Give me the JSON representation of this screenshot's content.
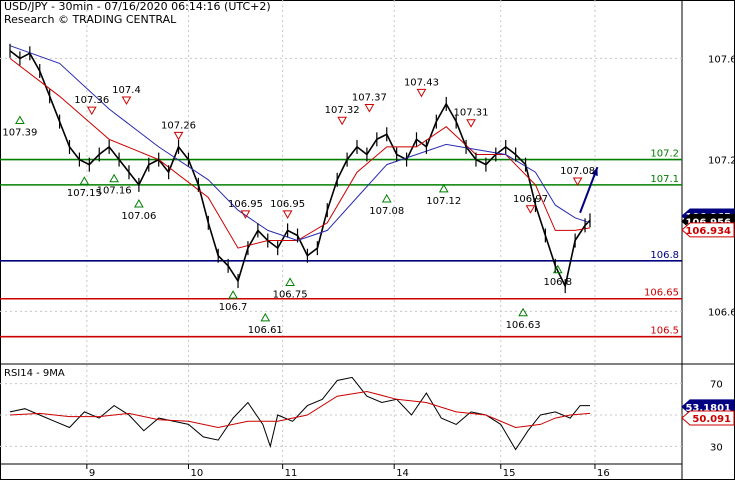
{
  "header": {
    "title": "USD/JPY - 30min - 07/16/2020 06:14:16 (UTC+2)",
    "source": "Research © TRADING CENTRAL"
  },
  "colors": {
    "price": "#000000",
    "ma_fast": "#cc0000",
    "ma_slow": "#2b2bb0",
    "resistance": "#008000",
    "pivot": "#000080",
    "support": "#cc0000",
    "arrow": "#000080",
    "grid": "#c8c8c8",
    "badge_dark": "#000000",
    "badge_blue": "#000080",
    "badge_red": "#cc0000"
  },
  "chart_data": [
    {
      "type": "line",
      "name": "price-panel",
      "ylim": [
        106.4,
        107.72
      ],
      "yticks": [
        106.6,
        107.2,
        107.6
      ],
      "ytick_labels": [
        "106.6",
        "107.2",
        "107.6"
      ],
      "xlim": [
        0,
        23.4
      ],
      "xticks": [
        3.1,
        7.2,
        11.0,
        15.5,
        19.8,
        23.6
      ],
      "xtick_labels": [
        "9",
        "10",
        "11",
        "14",
        "15",
        "16"
      ],
      "series": [
        {
          "key": "price",
          "x": [
            0,
            0.4,
            0.8,
            1.2,
            1.6,
            2.0,
            2.4,
            2.8,
            3.2,
            3.6,
            4.0,
            4.4,
            4.8,
            5.2,
            5.6,
            6.0,
            6.4,
            6.8,
            7.2,
            7.6,
            8.0,
            8.4,
            8.8,
            9.2,
            9.6,
            10.0,
            10.4,
            10.8,
            11.2,
            11.6,
            12.0,
            12.4,
            12.8,
            13.2,
            13.6,
            14.0,
            14.4,
            14.8,
            15.2,
            15.6,
            16.0,
            16.4,
            16.8,
            17.2,
            17.6,
            18.0,
            18.4,
            18.8,
            19.2,
            19.6,
            20.0,
            20.4,
            20.8,
            21.2,
            21.6,
            22.0,
            22.4,
            22.8,
            23.2,
            23.4
          ],
          "y": [
            107.63,
            107.6,
            107.62,
            107.55,
            107.45,
            107.35,
            107.25,
            107.2,
            107.18,
            107.22,
            107.25,
            107.2,
            107.15,
            107.1,
            107.18,
            107.2,
            107.15,
            107.25,
            107.2,
            107.1,
            106.95,
            106.82,
            106.78,
            106.72,
            106.85,
            106.92,
            106.88,
            106.85,
            106.92,
            106.9,
            106.82,
            106.85,
            107.0,
            107.12,
            107.2,
            107.25,
            107.22,
            107.28,
            107.3,
            107.22,
            107.2,
            107.28,
            107.25,
            107.35,
            107.42,
            107.35,
            107.25,
            107.2,
            107.18,
            107.22,
            107.25,
            107.22,
            107.18,
            107.02,
            106.9,
            106.78,
            106.7,
            106.88,
            106.94,
            106.96
          ]
        },
        {
          "key": "ma_fast",
          "x": [
            0,
            2.0,
            4.0,
            6.0,
            8.0,
            9.2,
            10.4,
            11.6,
            12.8,
            14.0,
            15.2,
            16.4,
            17.6,
            18.8,
            20.0,
            21.2,
            22.0,
            22.8,
            23.4
          ],
          "y": [
            107.6,
            107.45,
            107.28,
            107.2,
            107.05,
            106.85,
            106.88,
            106.88,
            106.95,
            107.15,
            107.25,
            107.25,
            107.33,
            107.22,
            107.22,
            107.1,
            106.92,
            106.92,
            106.93
          ]
        },
        {
          "key": "ma_slow",
          "x": [
            0,
            2.0,
            4.0,
            6.0,
            8.0,
            9.2,
            10.4,
            11.6,
            12.8,
            14.0,
            15.2,
            16.4,
            17.6,
            18.8,
            20.0,
            21.2,
            22.0,
            22.8,
            23.4
          ],
          "y": [
            107.65,
            107.58,
            107.4,
            107.25,
            107.12,
            107.0,
            106.92,
            106.88,
            106.92,
            107.05,
            107.18,
            107.22,
            107.26,
            107.24,
            107.22,
            107.15,
            107.02,
            106.97,
            106.95
          ]
        }
      ],
      "levels": [
        {
          "value": 107.2,
          "label": "107.2",
          "role": "resistance"
        },
        {
          "value": 107.1,
          "label": "107.1",
          "role": "resistance"
        },
        {
          "value": 106.8,
          "label": "106.8",
          "role": "pivot"
        },
        {
          "value": 106.65,
          "label": "106.65",
          "role": "support"
        },
        {
          "value": 106.5,
          "label": "106.5",
          "role": "support"
        }
      ],
      "last_price_badges": [
        {
          "value": 106.965,
          "label": "106.965",
          "style": "blue"
        },
        {
          "value": 106.956,
          "label": "106.956",
          "style": "dark"
        },
        {
          "value": 106.934,
          "label": "106.934",
          "style": "red"
        }
      ],
      "swing_markers": [
        {
          "x": 0.4,
          "y": 107.39,
          "label": "107.39",
          "kind": "low"
        },
        {
          "x": 3.0,
          "y": 107.15,
          "label": "107.15",
          "kind": "low"
        },
        {
          "x": 3.3,
          "y": 107.36,
          "label": "107.36",
          "kind": "high"
        },
        {
          "x": 4.2,
          "y": 107.16,
          "label": "107.16",
          "kind": "low"
        },
        {
          "x": 4.7,
          "y": 107.4,
          "label": "107.4",
          "kind": "high"
        },
        {
          "x": 5.2,
          "y": 107.06,
          "label": "107.06",
          "kind": "low"
        },
        {
          "x": 6.8,
          "y": 107.26,
          "label": "107.26",
          "kind": "high"
        },
        {
          "x": 9.5,
          "y": 106.95,
          "label": "106.95",
          "kind": "high"
        },
        {
          "x": 9.0,
          "y": 106.7,
          "label": "106.7",
          "kind": "low"
        },
        {
          "x": 10.3,
          "y": 106.61,
          "label": "106.61",
          "kind": "low"
        },
        {
          "x": 11.2,
          "y": 106.95,
          "label": "106.95",
          "kind": "high"
        },
        {
          "x": 11.3,
          "y": 106.75,
          "label": "106.75",
          "kind": "low"
        },
        {
          "x": 13.4,
          "y": 107.32,
          "label": "107.32",
          "kind": "high"
        },
        {
          "x": 14.5,
          "y": 107.37,
          "label": "107.37",
          "kind": "high"
        },
        {
          "x": 15.2,
          "y": 107.08,
          "label": "107.08",
          "kind": "low"
        },
        {
          "x": 16.6,
          "y": 107.43,
          "label": "107.43",
          "kind": "high"
        },
        {
          "x": 17.5,
          "y": 107.12,
          "label": "107.12",
          "kind": "low"
        },
        {
          "x": 18.6,
          "y": 107.31,
          "label": "107.31",
          "kind": "high"
        },
        {
          "x": 20.7,
          "y": 106.63,
          "label": "106.63",
          "kind": "low"
        },
        {
          "x": 21.0,
          "y": 106.97,
          "label": "106.97",
          "kind": "high"
        },
        {
          "x": 22.1,
          "y": 106.8,
          "label": "106.8",
          "kind": "low"
        },
        {
          "x": 22.9,
          "y": 107.08,
          "label": "107.08",
          "kind": "high"
        }
      ],
      "projection": {
        "from": [
          23.0,
          106.99
        ],
        "to": [
          23.7,
          107.17
        ]
      }
    },
    {
      "type": "line",
      "name": "rsi-panel",
      "title": "RSI14 - 9MA",
      "ylim": [
        20,
        80
      ],
      "yticks": [
        30,
        50,
        70
      ],
      "ytick_labels": [
        "30",
        "50",
        "70"
      ],
      "xlim": [
        0,
        23.4
      ],
      "series": [
        {
          "key": "rsi",
          "x": [
            0,
            0.6,
            1.2,
            1.8,
            2.4,
            3.0,
            3.6,
            4.2,
            4.8,
            5.4,
            6.0,
            6.6,
            7.2,
            7.8,
            8.4,
            9.0,
            9.6,
            10.2,
            10.5,
            10.8,
            11.4,
            12.0,
            12.6,
            13.2,
            13.8,
            14.4,
            15.0,
            15.6,
            16.2,
            16.8,
            17.4,
            18.0,
            18.6,
            19.2,
            19.8,
            20.4,
            20.9,
            21.4,
            22.0,
            22.6,
            23.0,
            23.4
          ],
          "y": [
            52,
            54,
            50,
            46,
            42,
            52,
            48,
            56,
            50,
            40,
            48,
            46,
            44,
            36,
            34,
            48,
            58,
            44,
            30,
            50,
            46,
            56,
            60,
            72,
            74,
            62,
            58,
            60,
            50,
            64,
            48,
            44,
            52,
            50,
            44,
            28,
            40,
            50,
            52,
            48,
            56,
            56
          ]
        },
        {
          "key": "rsi_ma",
          "x": [
            0,
            1.2,
            2.4,
            3.6,
            4.8,
            6.0,
            7.2,
            8.4,
            9.6,
            10.8,
            12.0,
            13.2,
            14.4,
            15.6,
            16.8,
            18.0,
            19.2,
            20.4,
            21.4,
            22.0,
            22.6,
            23.4
          ],
          "y": [
            50,
            51,
            49,
            49,
            51,
            47,
            46,
            42,
            46,
            46,
            50,
            62,
            65,
            60,
            58,
            52,
            50,
            42,
            44,
            48,
            50,
            51
          ]
        }
      ],
      "last_value_badges": [
        {
          "value": 53.1801,
          "label": "53.1801",
          "style": "blue"
        },
        {
          "value": 50.091,
          "label": "50.091",
          "style": "red"
        }
      ]
    }
  ]
}
